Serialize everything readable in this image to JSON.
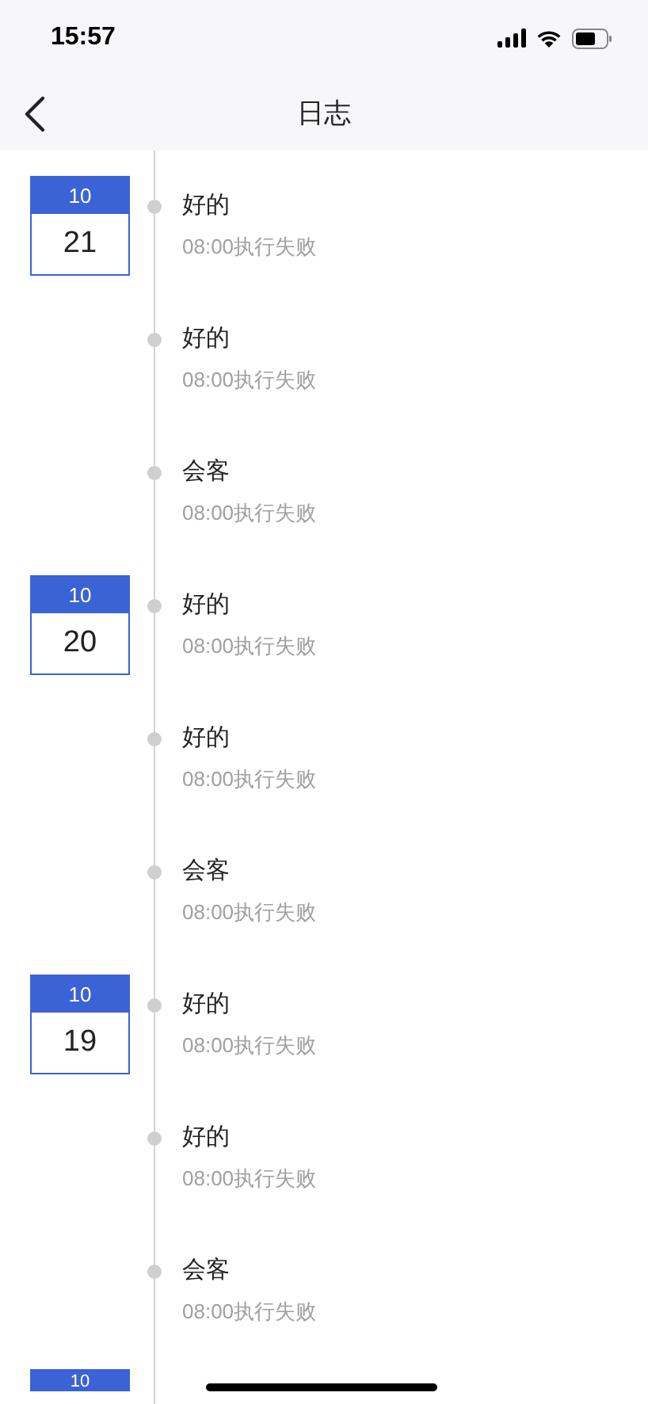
{
  "status_bar": {
    "time": "15:57"
  },
  "nav": {
    "title": "日志"
  },
  "days": [
    {
      "month": "10",
      "day": "21",
      "entries": [
        {
          "title": "好的",
          "detail": "08:00执行失败"
        },
        {
          "title": "好的",
          "detail": "08:00执行失败"
        },
        {
          "title": "会客",
          "detail": "08:00执行失败"
        }
      ]
    },
    {
      "month": "10",
      "day": "20",
      "entries": [
        {
          "title": "好的",
          "detail": "08:00执行失败"
        },
        {
          "title": "好的",
          "detail": "08:00执行失败"
        },
        {
          "title": "会客",
          "detail": "08:00执行失败"
        }
      ]
    },
    {
      "month": "10",
      "day": "19",
      "entries": [
        {
          "title": "好的",
          "detail": "08:00执行失败"
        },
        {
          "title": "好的",
          "detail": "08:00执行失败"
        },
        {
          "title": "会客",
          "detail": "08:00执行失败"
        }
      ]
    },
    {
      "month": "10"
    }
  ]
}
